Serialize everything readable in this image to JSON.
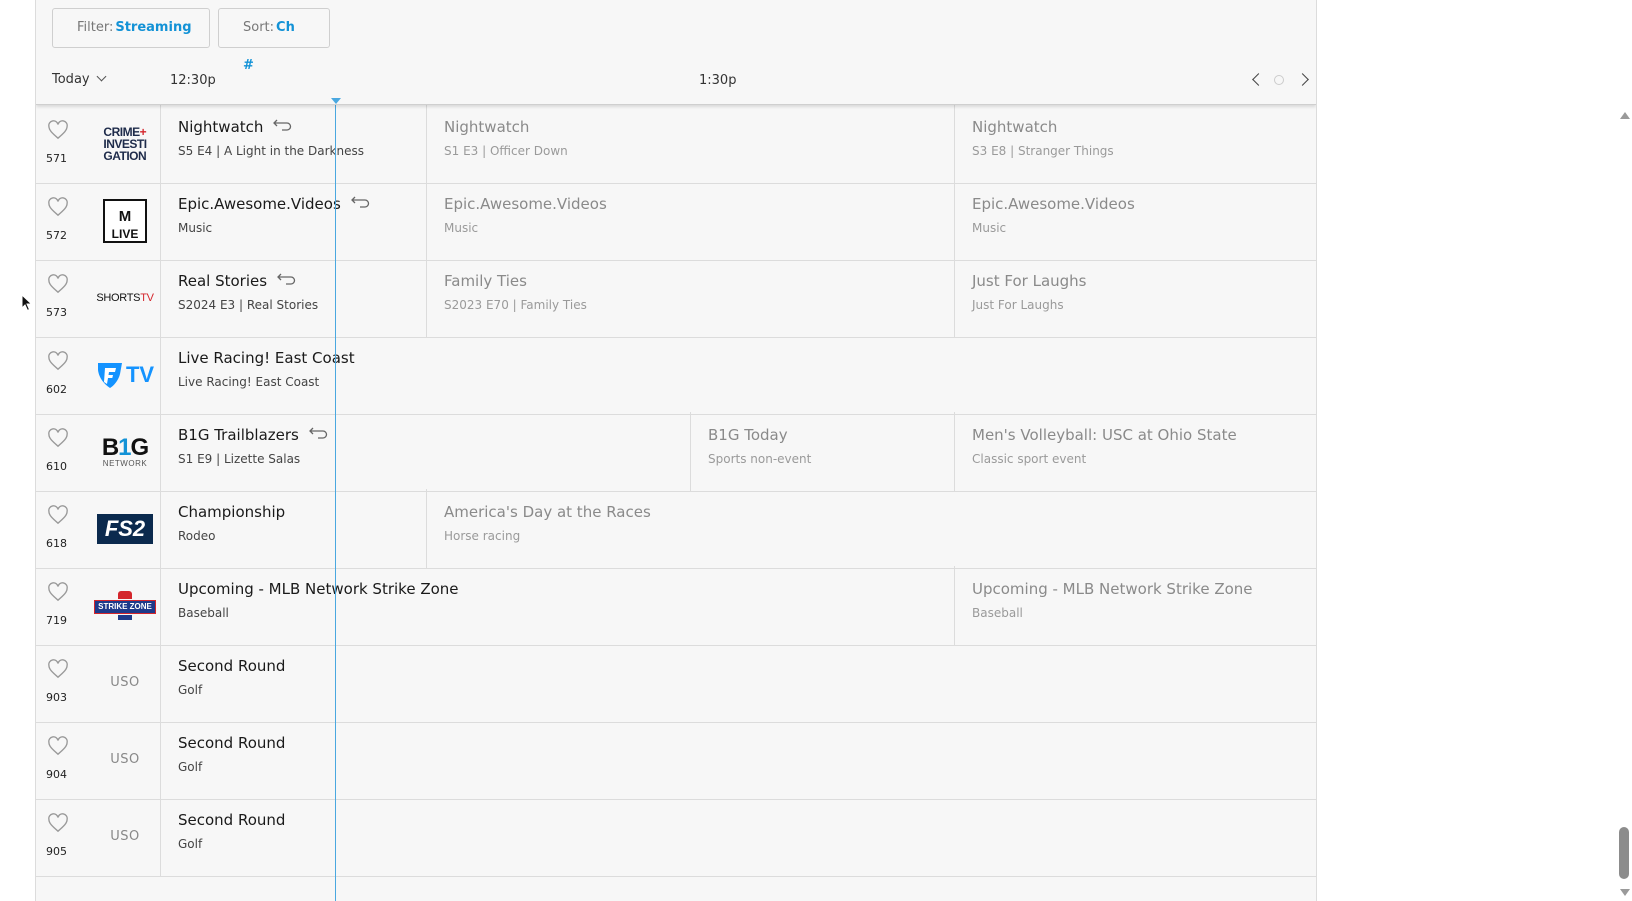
{
  "filter": {
    "label": "Filter:",
    "value": "Streaming"
  },
  "sort": {
    "label": "Sort:",
    "value": "Ch #"
  },
  "day_selector": {
    "label": "Today"
  },
  "timeline": {
    "times": [
      "12:30p",
      "1:30p"
    ]
  },
  "colors": {
    "accent": "#1392d6",
    "now_line": "#4aa8e0",
    "background": "#f7f7f7"
  },
  "rows": [
    {
      "channel": "571",
      "logo": "crime-investigation-logo",
      "logo_text": "CRIME+ INVESTIGATION",
      "programs": [
        {
          "title": "Nightwatch",
          "subtitle": "S5 E4 | A Light in the Darkness",
          "replay": true
        },
        {
          "title": "Nightwatch",
          "subtitle": "S1 E3 | Officer Down"
        },
        {
          "title": "Nightwatch",
          "subtitle": "S3 E8 | Stranger Things"
        }
      ]
    },
    {
      "channel": "572",
      "logo": "mtv-live-logo",
      "logo_text": "MTV LIVE",
      "programs": [
        {
          "title": "Epic.Awesome.Videos",
          "subtitle": "Music",
          "replay": true
        },
        {
          "title": "Epic.Awesome.Videos",
          "subtitle": "Music"
        },
        {
          "title": "Epic.Awesome.Videos",
          "subtitle": "Music"
        }
      ]
    },
    {
      "channel": "573",
      "logo": "shortstv-logo",
      "logo_text": "SHORTSTV",
      "programs": [
        {
          "title": "Real Stories",
          "subtitle": "S2024 E3 | Real Stories",
          "replay": true
        },
        {
          "title": "Family Ties",
          "subtitle": "S2023 E70 | Family Ties"
        },
        {
          "title": "Just For Laughs",
          "subtitle": "Just For Laughs"
        }
      ]
    },
    {
      "channel": "602",
      "logo": "fanduel-tv-logo",
      "logo_text": "TV",
      "programs": [
        {
          "title": "Live Racing! East Coast",
          "subtitle": "Live Racing! East Coast"
        }
      ]
    },
    {
      "channel": "610",
      "logo": "big-ten-network-logo",
      "logo_text": "B1G NETWORK",
      "programs": [
        {
          "title": "B1G Trailblazers",
          "subtitle": "S1 E9 | Lizette Salas",
          "replay": true
        },
        {
          "title": "B1G Today",
          "subtitle": "Sports non-event"
        },
        {
          "title": "Men's Volleyball: USC at Ohio State",
          "subtitle": "Classic sport event"
        }
      ]
    },
    {
      "channel": "618",
      "logo": "fs2-logo",
      "logo_text": "FS2",
      "programs": [
        {
          "title": "Championship",
          "subtitle": "Rodeo"
        },
        {
          "title": "America's Day at the Races",
          "subtitle": "Horse racing"
        }
      ]
    },
    {
      "channel": "719",
      "logo": "strike-zone-logo",
      "logo_text": "STRIKE ZONE",
      "programs": [
        {
          "title": "Upcoming - MLB Network Strike Zone",
          "subtitle": "Baseball"
        },
        {
          "title": "Upcoming - MLB Network Strike Zone",
          "subtitle": "Baseball"
        }
      ]
    },
    {
      "channel": "903",
      "logo": "uso-logo",
      "logo_text": "USO",
      "programs": [
        {
          "title": "Second Round",
          "subtitle": "Golf"
        }
      ]
    },
    {
      "channel": "904",
      "logo": "uso-logo",
      "logo_text": "USO",
      "programs": [
        {
          "title": "Second Round",
          "subtitle": "Golf"
        }
      ]
    },
    {
      "channel": "905",
      "logo": "uso-logo",
      "logo_text": "USO",
      "programs": [
        {
          "title": "Second Round",
          "subtitle": "Golf"
        }
      ]
    }
  ]
}
